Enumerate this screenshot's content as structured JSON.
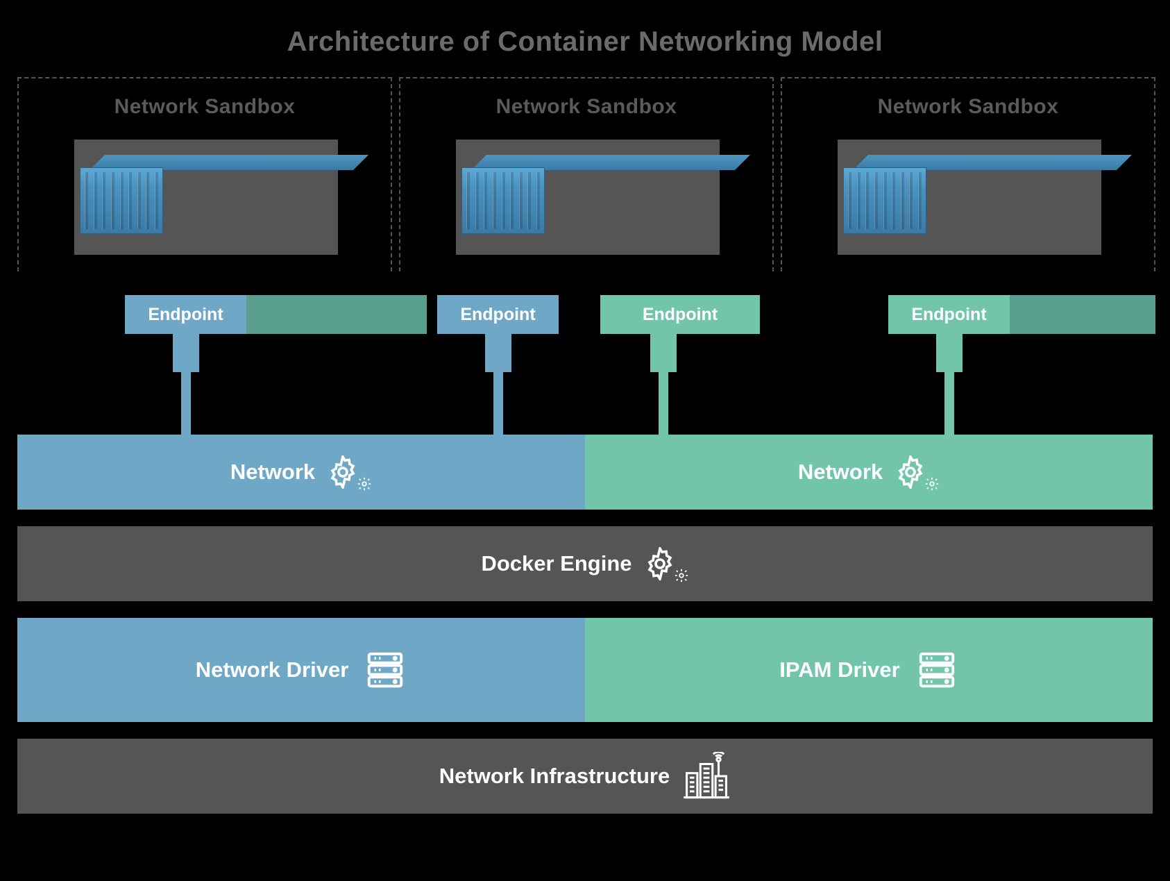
{
  "title": "Architecture of Container Networking Model",
  "sandboxes": [
    {
      "label": "Network Sandbox"
    },
    {
      "label": "Network Sandbox"
    },
    {
      "label": "Network Sandbox"
    }
  ],
  "endpoints": [
    {
      "label": "Endpoint",
      "color": "blue"
    },
    {
      "label": "Endpoint",
      "color": "blue"
    },
    {
      "label": "Endpoint",
      "color": "teal"
    },
    {
      "label": "Endpoint",
      "color": "teal"
    }
  ],
  "networks": [
    {
      "label": "Network",
      "color": "blue"
    },
    {
      "label": "Network",
      "color": "teal"
    }
  ],
  "engine": {
    "label": "Docker Engine"
  },
  "drivers": [
    {
      "label": "Network Driver",
      "color": "blue"
    },
    {
      "label": "IPAM Driver",
      "color": "teal"
    }
  ],
  "infrastructure": {
    "label": "Network Infrastructure"
  },
  "colors": {
    "blue": "#6fa8c6",
    "teal": "#72c4ab",
    "grey": "#555555"
  }
}
